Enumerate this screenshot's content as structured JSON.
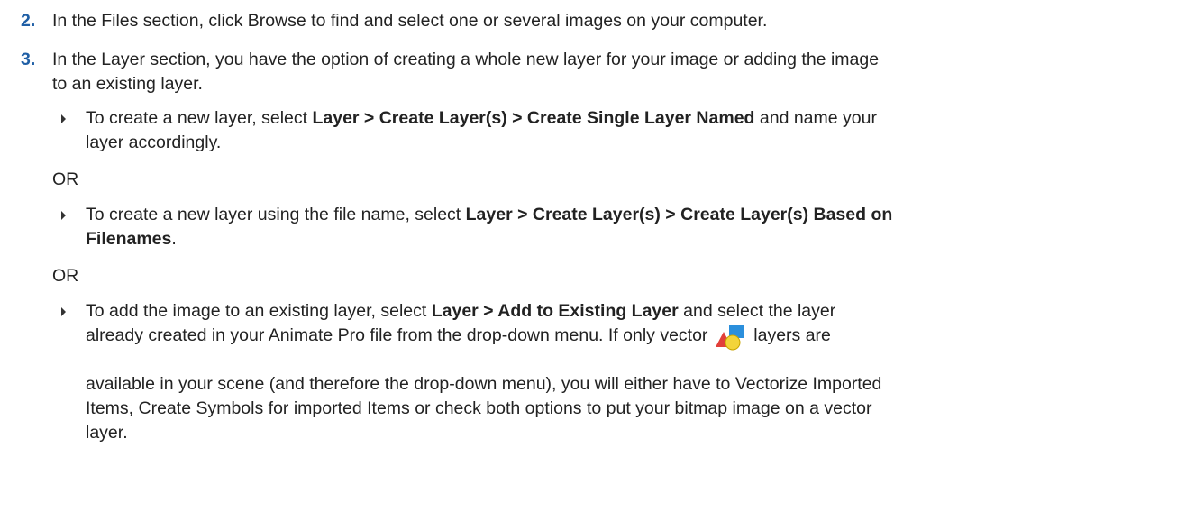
{
  "steps": [
    {
      "number": "2.",
      "text": "In the Files section, click Browse to find and select one or several images on your computer."
    },
    {
      "number": "3.",
      "line1": "In the Layer section, you have the option of creating a whole new layer for your image or adding the image",
      "line2": "to an existing layer.",
      "options": [
        {
          "pre": "To create a new layer, select ",
          "bold": "Layer > Create Layer(s) > Create Single Layer Named",
          "post": " and name your",
          "cont": "layer accordingly."
        },
        {
          "pre": "To create a new layer using the file name, select ",
          "bold": "Layer > Create Layer(s) > Create Layer(s) Based on",
          "bold_cont": "Filenames",
          "post": "."
        },
        {
          "pre": "To add the image to an existing layer, select ",
          "bold": "Layer > Add to Existing Layer",
          "post": " and select the layer",
          "line2_pre": "already created in your Animate Pro file from the drop-down menu. If only vector ",
          "line2_post": " layers are",
          "line3": "available in your scene (and therefore the drop-down menu), you will either have to Vectorize Imported",
          "line4": "Items, Create Symbols for imported Items or check both options to put your bitmap image on a vector",
          "line5": "layer.",
          "icon": "vector-layer-icon"
        }
      ],
      "or_label": "OR"
    }
  ],
  "colors": {
    "step_number": "#1f5fa6",
    "icon_red": "#e2403a",
    "icon_blue": "#2b8fdc",
    "icon_yellow": "#f3d43a"
  }
}
